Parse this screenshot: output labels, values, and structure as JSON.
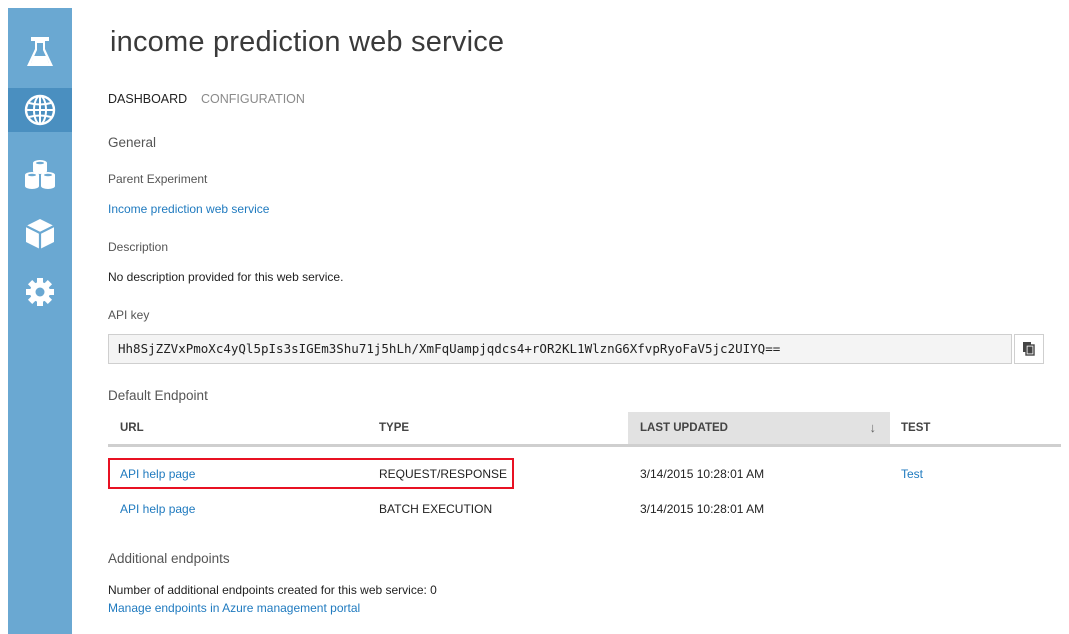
{
  "sidebar": {
    "items": [
      {
        "icon": "flask-icon"
      },
      {
        "icon": "globe-icon"
      },
      {
        "icon": "datasets-icon"
      },
      {
        "icon": "cube-icon"
      },
      {
        "icon": "gear-icon"
      }
    ],
    "active_index": 1,
    "colors": {
      "background": "#6aa8d2",
      "active": "#4a8fc0"
    }
  },
  "page": {
    "title": "income prediction web service",
    "tabs": [
      {
        "label": "DASHBOARD",
        "active": true
      },
      {
        "label": "CONFIGURATION",
        "active": false
      }
    ]
  },
  "general": {
    "heading": "General",
    "parent_experiment_label": "Parent Experiment",
    "parent_experiment_link": "Income prediction web service",
    "description_label": "Description",
    "description_value": "No description provided for this web service.",
    "api_key_label": "API key",
    "api_key_value": "Hh8SjZZVxPmoXc4yQl5pIs3sIGEm3Shu71j5hLh/XmFqUampjqdcs4+rOR2KL1WlznG6XfvpRyoFaV5jc2UIYQ=="
  },
  "default_endpoint": {
    "heading": "Default Endpoint",
    "columns": [
      "URL",
      "TYPE",
      "LAST UPDATED",
      "TEST"
    ],
    "sort_column": "LAST UPDATED",
    "sort_indicator": "↓",
    "rows": [
      {
        "url": "API help page",
        "type": "REQUEST/RESPONSE",
        "last_updated": "3/14/2015 10:28:01 AM",
        "test": "Test"
      },
      {
        "url": "API help page",
        "type": "BATCH EXECUTION",
        "last_updated": "3/14/2015 10:28:01 AM",
        "test": ""
      }
    ],
    "highlight_color": "#e81123"
  },
  "additional": {
    "heading": "Additional endpoints",
    "count_text": "Number of additional endpoints created for this web service: 0",
    "manage_link": "Manage endpoints in Azure management portal"
  },
  "colors": {
    "link": "#1f7abf",
    "text": "#333333"
  }
}
